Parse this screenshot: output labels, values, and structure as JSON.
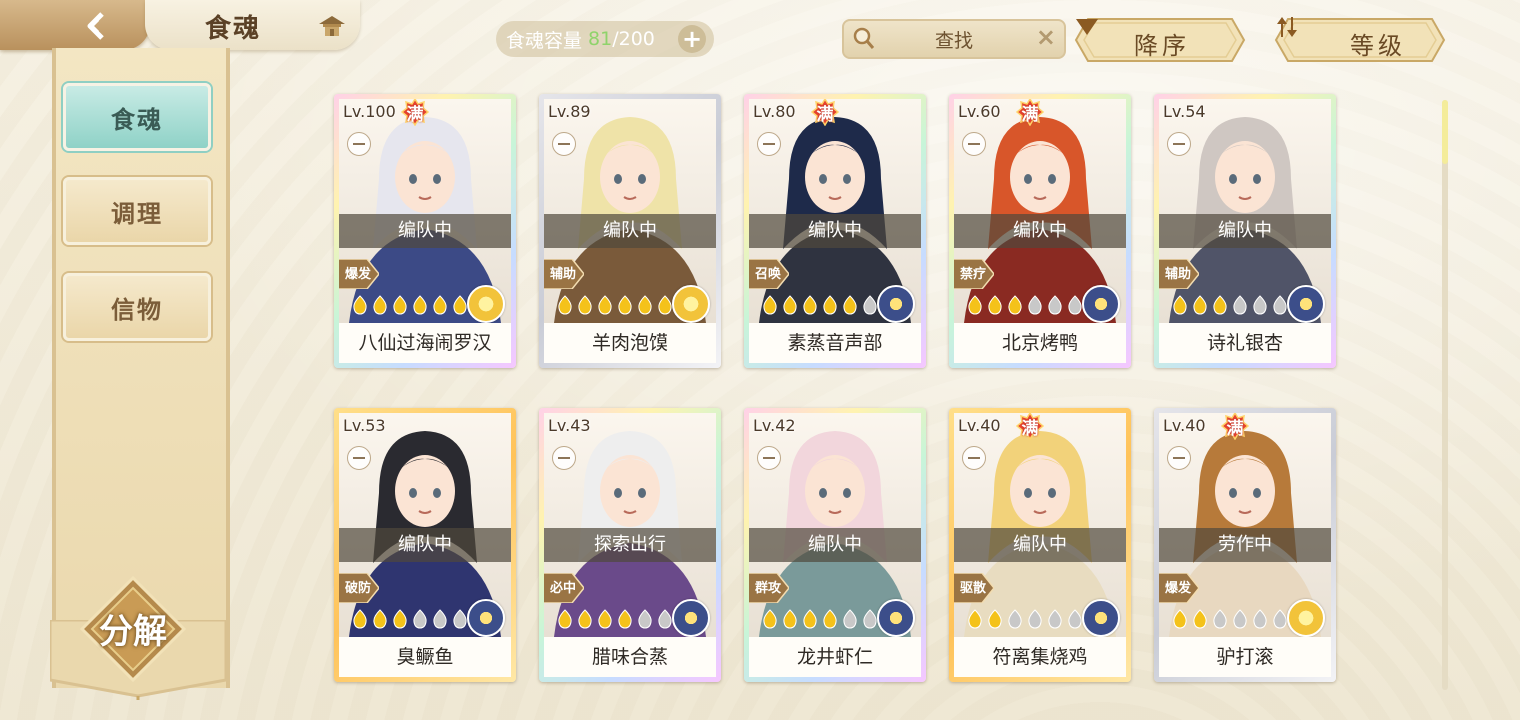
{
  "header": {
    "title": "食魂",
    "capacity_label": "食魂容量",
    "capacity_current": "81",
    "capacity_separator": "/",
    "capacity_max": "200",
    "search_label": "查找",
    "sort_order_label": "降序",
    "sort_key_label": "等级"
  },
  "sidebar": {
    "items": [
      {
        "label": "食魂",
        "active": true
      },
      {
        "label": "调理",
        "active": false
      },
      {
        "label": "信物",
        "active": false
      }
    ],
    "decompose_label": "分解"
  },
  "cards": [
    {
      "level": "Lv.100",
      "full": true,
      "full_label": "满",
      "status": "编队中",
      "role": "爆发",
      "stars": 6,
      "stars_lit": 6,
      "element": "gold",
      "name": "八仙过海闹罗汉",
      "frame": "rainbow",
      "art": "#3c4a86",
      "hair": "#e6e6ee"
    },
    {
      "level": "Lv.89",
      "full": false,
      "full_label": "",
      "status": "编队中",
      "role": "辅助",
      "stars": 6,
      "stars_lit": 6,
      "element": "gold",
      "name": "羊肉泡馍",
      "frame": "silver",
      "art": "#7a5a3a",
      "hair": "#efe3a8"
    },
    {
      "level": "Lv.80",
      "full": true,
      "full_label": "满",
      "status": "编队中",
      "role": "召唤",
      "stars": 6,
      "stars_lit": 5,
      "element": "blue",
      "name": "素蒸音声部",
      "frame": "rainbow",
      "art": "#2f3340",
      "hair": "#1e2a4a"
    },
    {
      "level": "Lv.60",
      "full": true,
      "full_label": "满",
      "status": "编队中",
      "role": "禁疗",
      "stars": 6,
      "stars_lit": 3,
      "element": "blue",
      "name": "北京烤鸭",
      "frame": "rainbow",
      "art": "#8a2a22",
      "hair": "#d8562a"
    },
    {
      "level": "Lv.54",
      "full": false,
      "full_label": "",
      "status": "编队中",
      "role": "辅助",
      "stars": 6,
      "stars_lit": 3,
      "element": "blue",
      "name": "诗礼银杏",
      "frame": "rainbow",
      "art": "#505468",
      "hair": "#cfc7c2"
    },
    {
      "level": "Lv.53",
      "full": false,
      "full_label": "",
      "status": "编队中",
      "role": "破防",
      "stars": 6,
      "stars_lit": 3,
      "element": "blue",
      "name": "臭鳜鱼",
      "frame": "gold",
      "art": "#2f3570",
      "hair": "#2a2a30"
    },
    {
      "level": "Lv.43",
      "full": false,
      "full_label": "",
      "status": "探索出行",
      "role": "必中",
      "stars": 6,
      "stars_lit": 4,
      "element": "blue",
      "name": "腊味合蒸",
      "frame": "rainbow",
      "art": "#6a4a8a",
      "hair": "#eeeeee"
    },
    {
      "level": "Lv.42",
      "full": false,
      "full_label": "",
      "status": "编队中",
      "role": "群攻",
      "stars": 6,
      "stars_lit": 4,
      "element": "blue",
      "name": "龙井虾仁",
      "frame": "rainbow",
      "art": "#7a9a9a",
      "hair": "#f2d6dc"
    },
    {
      "level": "Lv.40",
      "full": true,
      "full_label": "满",
      "status": "编队中",
      "role": "驱散",
      "stars": 6,
      "stars_lit": 2,
      "element": "blue",
      "name": "符离集烧鸡",
      "frame": "gold",
      "art": "#e8dcc0",
      "hair": "#f2d27a"
    },
    {
      "level": "Lv.40",
      "full": true,
      "full_label": "满",
      "status": "劳作中",
      "role": "爆发",
      "stars": 6,
      "stars_lit": 2,
      "element": "gold",
      "name": "驴打滚",
      "frame": "silver",
      "art": "#e8d8c0",
      "hair": "#b77a3a"
    }
  ],
  "colors": {
    "rainbow": "linear-gradient(135deg,#ffd1e8,#fff3b0,#c8f5d8,#c7dcff,#f6c7ff)",
    "gold": "linear-gradient(135deg,#ffdf8a,#ffc35a,#ffe8a6)",
    "silver": "linear-gradient(135deg,#e5e5ea,#c9ccd6,#f3f3f6)",
    "star_lit": "#f4c21a",
    "star_dim": "#c8c8c8",
    "accent_teal": "#8fd2c7"
  }
}
